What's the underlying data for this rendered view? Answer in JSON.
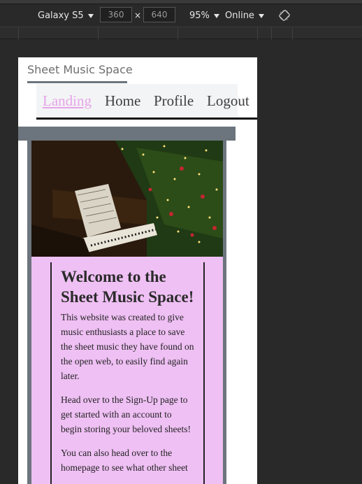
{
  "devtools": {
    "device": "Galaxy S5",
    "width": "360",
    "height": "640",
    "times": "×",
    "zoom": "95%",
    "network": "Online",
    "rotate_icon": "rotate-icon"
  },
  "site": {
    "brand": "Sheet Music Space",
    "nav": {
      "landing": "Landing",
      "home": "Home",
      "profile": "Profile",
      "logout": "Logout"
    },
    "hero_alt": "piano-christmas-tree-image",
    "welcome": "Welcome to the Sheet Music Space!",
    "paragraphs": [
      "This website was created to give music enthusiasts a place to save the sheet music they have found on the open web, to easily find again later.",
      "Head over to the Sign-Up page to get started with an account to begin storing your beloved sheets!",
      "You can also head over to the homepage to see what other sheet"
    ],
    "colors": {
      "accent": "#e7a4ea",
      "content_bg": "#efc0f4",
      "bar": "#6c757d"
    }
  }
}
